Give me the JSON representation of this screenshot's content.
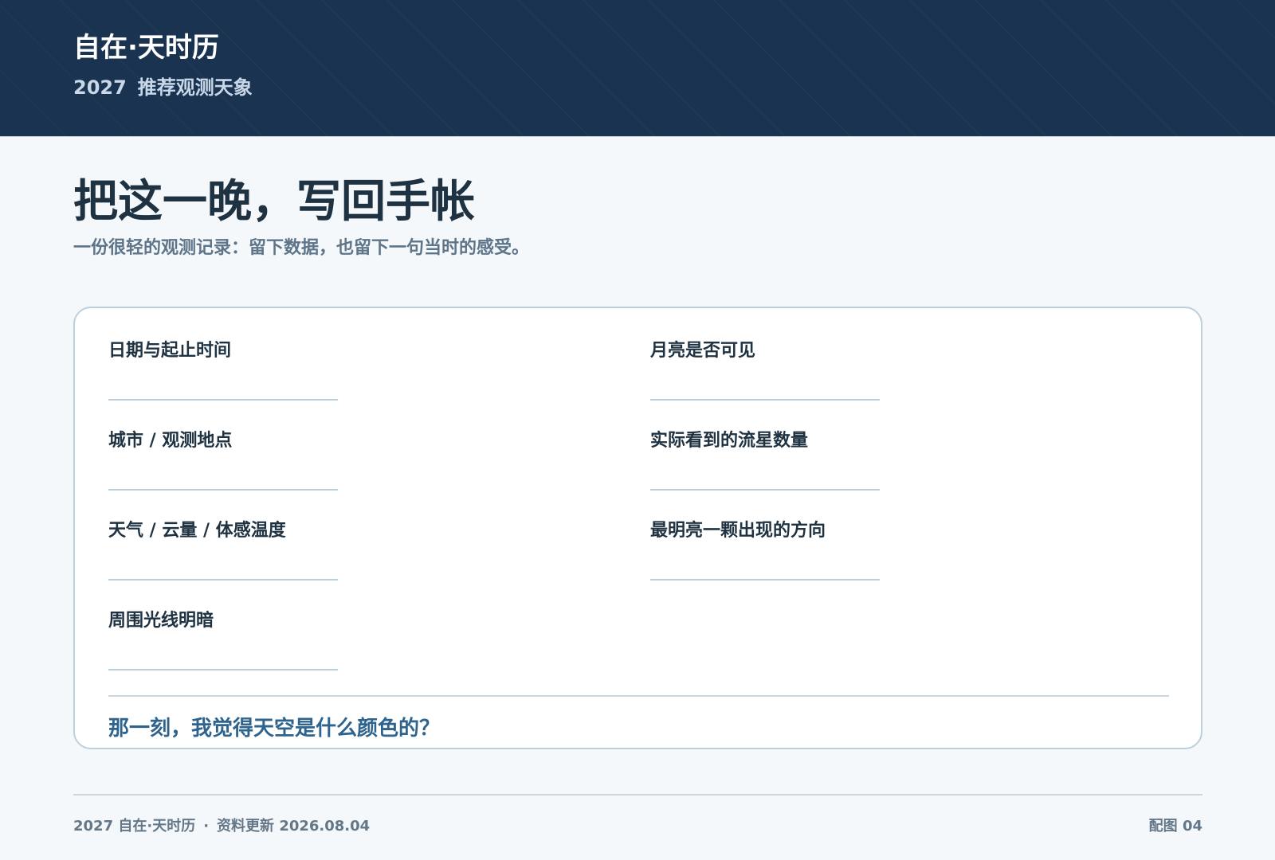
{
  "colors": {
    "header_bg": "#1a3350",
    "page_bg": "#f5f8fb",
    "title_text": "#1f3242",
    "muted_text": "#5d7489",
    "accent": "#2e638e",
    "rule": "#bccfdd"
  },
  "header": {
    "brand": "自在·天时历",
    "year": "2027",
    "subtitle": "推荐观测天象"
  },
  "main": {
    "title": "把这一晚，写回手帐",
    "lead": "一份很轻的观测记录：留下数据，也留下一句当时的感受。"
  },
  "form": {
    "fields": [
      {
        "label": "日期与起止时间"
      },
      {
        "label": "城市 / 观测地点"
      },
      {
        "label": "天气 / 云量 / 体感温度"
      },
      {
        "label": "周围光线明暗"
      },
      {
        "label": "月亮是否可见"
      },
      {
        "label": "实际看到的流星数量"
      },
      {
        "label": "最明亮一颗出现的方向"
      }
    ],
    "prompt": "那一刻，我觉得天空是什么颜色的？"
  },
  "footer": {
    "left": "2027 自在·天时历",
    "separator": "·",
    "updated": "资料更新 2026.08.04",
    "right": "配图 04"
  }
}
